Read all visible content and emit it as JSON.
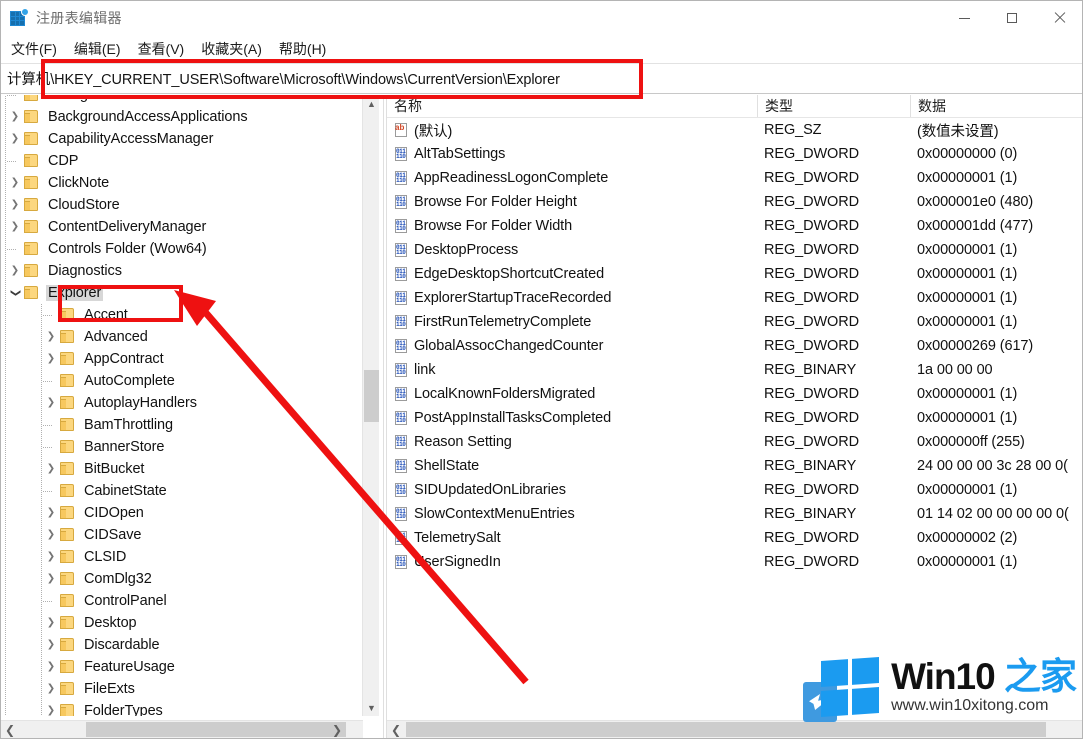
{
  "window": {
    "title": "注册表编辑器",
    "icon": "registry-editor-icon",
    "minimize_label": "最小化",
    "maximize_label": "最大化",
    "close_label": "关闭"
  },
  "menubar": {
    "items": [
      {
        "label": "文件(F)",
        "name": "menu-file"
      },
      {
        "label": "编辑(E)",
        "name": "menu-edit"
      },
      {
        "label": "查看(V)",
        "name": "menu-view"
      },
      {
        "label": "收藏夹(A)",
        "name": "menu-favorites"
      },
      {
        "label": "帮助(H)",
        "name": "menu-help"
      }
    ]
  },
  "address": {
    "path": "计算机\\HKEY_CURRENT_USER\\Software\\Microsoft\\Windows\\CurrentVersion\\Explorer"
  },
  "tree": {
    "nodes": [
      {
        "label": "Background",
        "depth": 2,
        "expander": "none",
        "clipped": true
      },
      {
        "label": "BackgroundAccessApplications",
        "depth": 2,
        "expander": "collapsed"
      },
      {
        "label": "CapabilityAccessManager",
        "depth": 2,
        "expander": "collapsed"
      },
      {
        "label": "CDP",
        "depth": 2,
        "expander": "none"
      },
      {
        "label": "ClickNote",
        "depth": 2,
        "expander": "collapsed"
      },
      {
        "label": "CloudStore",
        "depth": 2,
        "expander": "collapsed"
      },
      {
        "label": "ContentDeliveryManager",
        "depth": 2,
        "expander": "collapsed"
      },
      {
        "label": "Controls Folder (Wow64)",
        "depth": 2,
        "expander": "none"
      },
      {
        "label": "Diagnostics",
        "depth": 2,
        "expander": "collapsed"
      },
      {
        "label": "Explorer",
        "depth": 2,
        "expander": "expanded",
        "selected": true
      },
      {
        "label": "Accent",
        "depth": 3,
        "expander": "none"
      },
      {
        "label": "Advanced",
        "depth": 3,
        "expander": "collapsed"
      },
      {
        "label": "AppContract",
        "depth": 3,
        "expander": "collapsed"
      },
      {
        "label": "AutoComplete",
        "depth": 3,
        "expander": "none"
      },
      {
        "label": "AutoplayHandlers",
        "depth": 3,
        "expander": "collapsed"
      },
      {
        "label": "BamThrottling",
        "depth": 3,
        "expander": "none"
      },
      {
        "label": "BannerStore",
        "depth": 3,
        "expander": "none"
      },
      {
        "label": "BitBucket",
        "depth": 3,
        "expander": "collapsed"
      },
      {
        "label": "CabinetState",
        "depth": 3,
        "expander": "none"
      },
      {
        "label": "CIDOpen",
        "depth": 3,
        "expander": "collapsed"
      },
      {
        "label": "CIDSave",
        "depth": 3,
        "expander": "collapsed"
      },
      {
        "label": "CLSID",
        "depth": 3,
        "expander": "collapsed"
      },
      {
        "label": "ComDlg32",
        "depth": 3,
        "expander": "collapsed"
      },
      {
        "label": "ControlPanel",
        "depth": 3,
        "expander": "none"
      },
      {
        "label": "Desktop",
        "depth": 3,
        "expander": "collapsed"
      },
      {
        "label": "Discardable",
        "depth": 3,
        "expander": "collapsed"
      },
      {
        "label": "FeatureUsage",
        "depth": 3,
        "expander": "collapsed"
      },
      {
        "label": "FileExts",
        "depth": 3,
        "expander": "collapsed"
      },
      {
        "label": "FolderTypes",
        "depth": 3,
        "expander": "collapsed",
        "clipped": true
      }
    ]
  },
  "values": {
    "columns": [
      {
        "label": "名称",
        "name": "column-name"
      },
      {
        "label": "类型",
        "name": "column-type"
      },
      {
        "label": "数据",
        "name": "column-data"
      }
    ],
    "rows": [
      {
        "name": "(默认)",
        "icon": "string-value-icon",
        "type": "REG_SZ",
        "data": "(数值未设置)"
      },
      {
        "name": "AltTabSettings",
        "icon": "dword-value-icon",
        "type": "REG_DWORD",
        "data": "0x00000000 (0)"
      },
      {
        "name": "AppReadinessLogonComplete",
        "icon": "dword-value-icon",
        "type": "REG_DWORD",
        "data": "0x00000001 (1)"
      },
      {
        "name": "Browse For Folder Height",
        "icon": "dword-value-icon",
        "type": "REG_DWORD",
        "data": "0x000001e0 (480)"
      },
      {
        "name": "Browse For Folder Width",
        "icon": "dword-value-icon",
        "type": "REG_DWORD",
        "data": "0x000001dd (477)"
      },
      {
        "name": "DesktopProcess",
        "icon": "dword-value-icon",
        "type": "REG_DWORD",
        "data": "0x00000001 (1)"
      },
      {
        "name": "EdgeDesktopShortcutCreated",
        "icon": "dword-value-icon",
        "type": "REG_DWORD",
        "data": "0x00000001 (1)"
      },
      {
        "name": "ExplorerStartupTraceRecorded",
        "icon": "dword-value-icon",
        "type": "REG_DWORD",
        "data": "0x00000001 (1)"
      },
      {
        "name": "FirstRunTelemetryComplete",
        "icon": "dword-value-icon",
        "type": "REG_DWORD",
        "data": "0x00000001 (1)"
      },
      {
        "name": "GlobalAssocChangedCounter",
        "icon": "dword-value-icon",
        "type": "REG_DWORD",
        "data": "0x00000269 (617)"
      },
      {
        "name": "link",
        "icon": "binary-value-icon",
        "type": "REG_BINARY",
        "data": "1a 00 00 00"
      },
      {
        "name": "LocalKnownFoldersMigrated",
        "icon": "dword-value-icon",
        "type": "REG_DWORD",
        "data": "0x00000001 (1)"
      },
      {
        "name": "PostAppInstallTasksCompleted",
        "icon": "dword-value-icon",
        "type": "REG_DWORD",
        "data": "0x00000001 (1)"
      },
      {
        "name": "Reason Setting",
        "icon": "dword-value-icon",
        "type": "REG_DWORD",
        "data": "0x000000ff (255)"
      },
      {
        "name": "ShellState",
        "icon": "binary-value-icon",
        "type": "REG_BINARY",
        "data": "24 00 00 00 3c 28 00 0("
      },
      {
        "name": "SIDUpdatedOnLibraries",
        "icon": "dword-value-icon",
        "type": "REG_DWORD",
        "data": "0x00000001 (1)"
      },
      {
        "name": "SlowContextMenuEntries",
        "icon": "binary-value-icon",
        "type": "REG_BINARY",
        "data": "01 14 02 00 00 00 00 0("
      },
      {
        "name": "TelemetrySalt",
        "icon": "dword-value-icon",
        "type": "REG_DWORD",
        "data": "0x00000002 (2)"
      },
      {
        "name": "UserSignedIn",
        "icon": "dword-value-icon",
        "type": "REG_DWORD",
        "data": "0x00000001 (1)"
      }
    ]
  },
  "annotations": {
    "highlight_color": "#ee1111",
    "address_box": "address-bar-highlight",
    "explorer_box": "explorer-key-highlight",
    "arrow": "pointer-arrow-to-explorer"
  },
  "watermark": {
    "brand_en": "Win10 ",
    "brand_cn": "之家",
    "url": "www.win10xitong.com"
  }
}
